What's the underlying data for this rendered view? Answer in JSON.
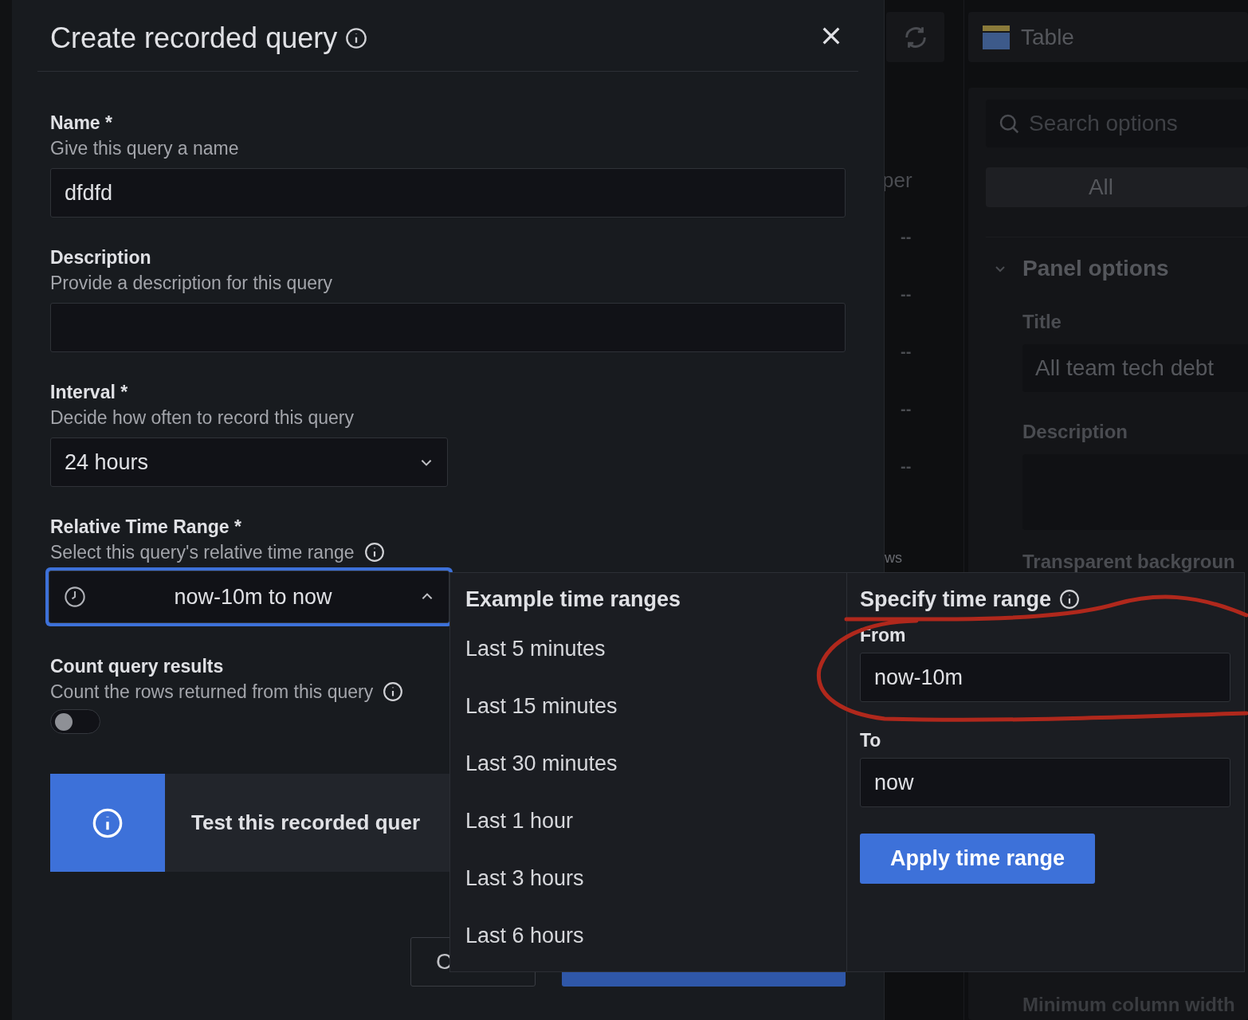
{
  "background": {
    "toolbar_title": "Table",
    "search_placeholder": "Search options",
    "filter_tab": "All",
    "section": "Panel options",
    "title_label": "Title",
    "title_value": "All team tech debt",
    "description_label": "Description",
    "next_label": "Transparent backgroun",
    "last_label": "Minimum column width",
    "column_fragment": "per",
    "column_cells": [
      "--",
      "--",
      "--",
      "--",
      "--"
    ],
    "footer_fragment": "ws"
  },
  "modal": {
    "title": "Create recorded query",
    "fields": [
      {
        "kind": "text",
        "label": "Name *",
        "description": "Give this query a name",
        "value": "dfdfd"
      },
      {
        "kind": "text",
        "label": "Description",
        "description": "Provide a description for this query"
      },
      {
        "kind": "select",
        "label": "Interval *",
        "description": "Decide how often to record this query",
        "value": "24 hours"
      },
      {
        "kind": "timerange",
        "label": "Relative Time Range *",
        "description": "Select this query's relative time range",
        "info": true,
        "value": "now-10m to now",
        "expanded": true
      },
      {
        "kind": "toggle",
        "label": "Count query results",
        "description": "Count the rows returned from this query",
        "info": true,
        "on": false
      }
    ],
    "alert": {
      "text": "Test this recorded quer"
    },
    "cancel_button": "C"
  },
  "popover": {
    "examples_title": "Example time ranges",
    "examples": [
      "Last 5 minutes",
      "Last 15 minutes",
      "Last 30 minutes",
      "Last 1 hour",
      "Last 3 hours",
      "Last 6 hours"
    ],
    "specify_title": "Specify time range",
    "from_label": "From",
    "from_value": "now-10m",
    "to_label": "To",
    "to_value": "now",
    "apply": "Apply time range"
  }
}
